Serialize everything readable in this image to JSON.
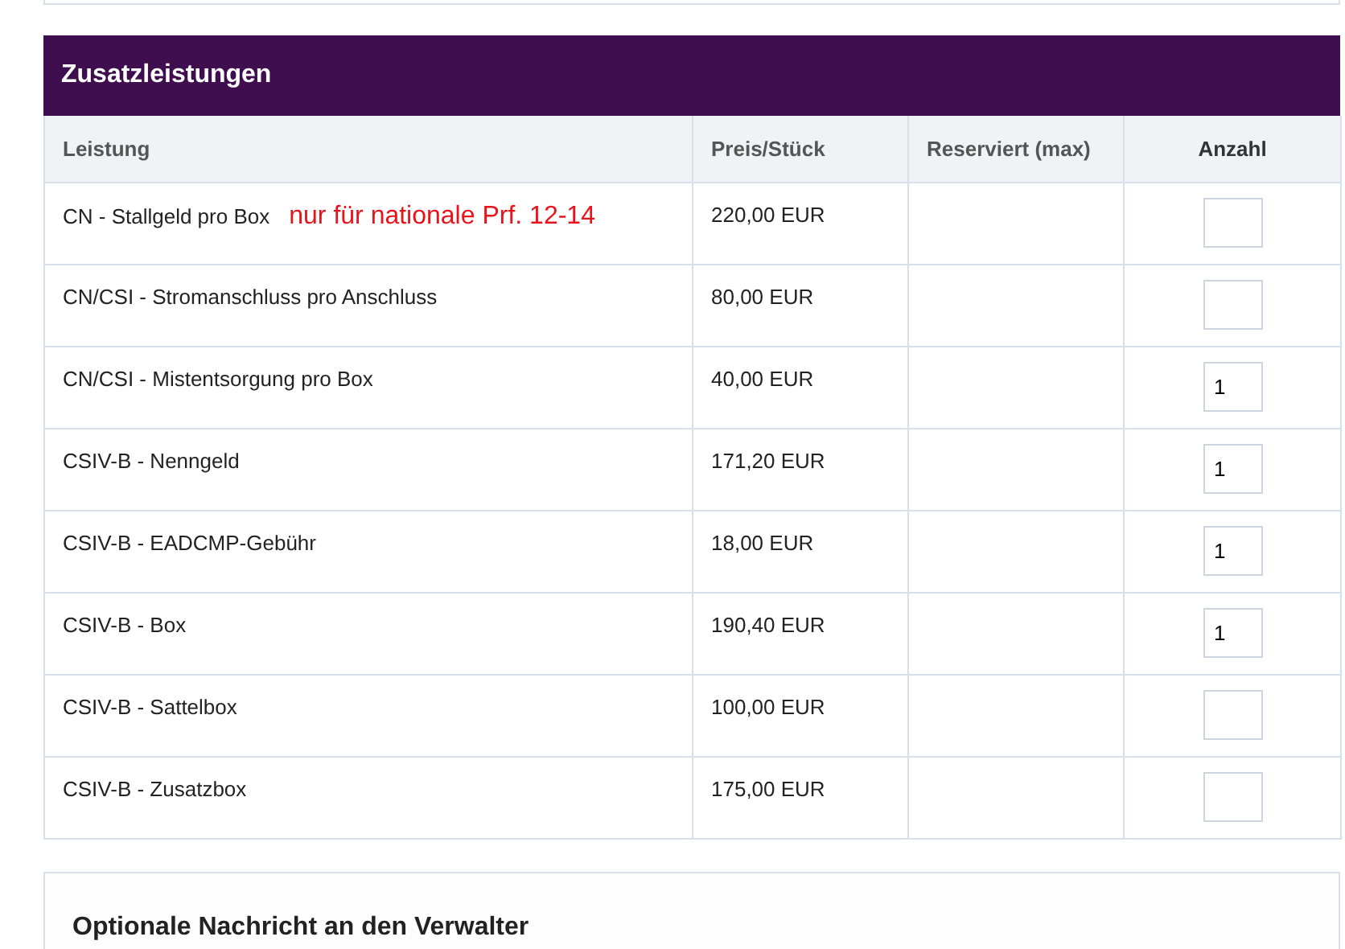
{
  "section": {
    "title": "Zusatzleistungen"
  },
  "table": {
    "columns": [
      "Leistung",
      "Preis/Stück",
      "Reserviert (max)",
      "Anzahl"
    ],
    "rows": [
      {
        "service": "CN - Stallgeld pro Box",
        "note": "nur für nationale Prf. 12-14",
        "price": "220,00 EUR"
      },
      {
        "service": "CN/CSI - Stromanschluss pro Anschluss",
        "price": "80,00 EUR"
      },
      {
        "service": "CN/CSI - Mistentsorgung pro Box",
        "price": "40,00 EUR",
        "quantity": "1"
      },
      {
        "service": "CSIV-B - Nenngeld",
        "price": "171,20 EUR",
        "quantity": "1"
      },
      {
        "service": "CSIV-B - EADCMP-Gebühr",
        "price": "18,00 EUR",
        "quantity": "1"
      },
      {
        "service": "CSIV-B - Box",
        "price": "190,40 EUR",
        "quantity": "1"
      },
      {
        "service": "CSIV-B - Sattelbox",
        "price": "100,00 EUR"
      },
      {
        "service": "CSIV-B - Zusatzbox",
        "price": "175,00 EUR"
      }
    ]
  },
  "message_panel": {
    "title": "Optionale Nachricht an den Verwalter"
  }
}
